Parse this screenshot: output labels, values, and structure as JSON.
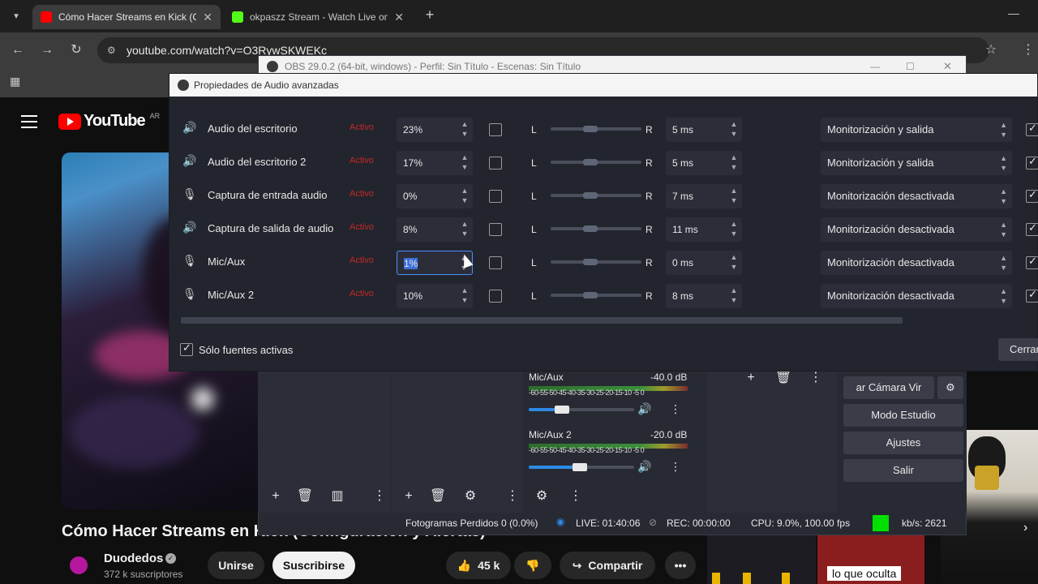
{
  "browser": {
    "tabs": [
      {
        "title": "Cómo Hacer Streams en Kick (C",
        "favicon_color": "#ff0000",
        "active": true
      },
      {
        "title": "okpaszz Stream - Watch Live on",
        "favicon_color": "#53fc18",
        "active": false
      }
    ],
    "url": "youtube.com/watch?v=O3RywSKWEKc"
  },
  "youtube": {
    "logo_text": "YouTube",
    "region": "AR",
    "video_title": "Cómo Hacer Streams en Kick (Configuración y Alertas)",
    "channel_name": "Duodedos",
    "subscribers": "372 k suscriptores",
    "join_label": "Unirse",
    "subscribe_label": "Suscribirse",
    "likes": "45 k",
    "share_label": "Compartir",
    "thumb_caption": "lo que oculta"
  },
  "obs": {
    "window_title": "OBS 29.0.2 (64-bit, windows) - Perfil: Sin Título - Escenas: Sin Título",
    "dialog_title": "Propiedades de Audio avanzadas",
    "rows": [
      {
        "icon": "speaker",
        "name": "Audio del escritorio",
        "sync": "Activo",
        "volume": "23%",
        "mono": false,
        "left": "L",
        "right": "R",
        "offset": "5 ms",
        "monitoring": "Monitorización y salida",
        "track": true
      },
      {
        "icon": "speaker",
        "name": "Audio del escritorio 2",
        "sync": "Activo",
        "volume": "17%",
        "mono": false,
        "left": "L",
        "right": "R",
        "offset": "5 ms",
        "monitoring": "Monitorización y salida",
        "track": true
      },
      {
        "icon": "mic",
        "name": "Captura de entrada audio",
        "sync": "Activo",
        "volume": "0%",
        "mono": false,
        "left": "L",
        "right": "R",
        "offset": "7 ms",
        "monitoring": "Monitorización desactivada",
        "track": true
      },
      {
        "icon": "speaker",
        "name": "Captura de salida de audio",
        "sync": "Activo",
        "volume": "8%",
        "mono": false,
        "left": "L",
        "right": "R",
        "offset": "11 ms",
        "monitoring": "Monitorización desactivada",
        "track": true
      },
      {
        "icon": "mic",
        "name": "Mic/Aux",
        "sync": "Activo",
        "volume": "1%",
        "mono": false,
        "left": "L",
        "right": "R",
        "offset": "0 ms",
        "monitoring": "Monitorización desactivada",
        "track": true
      },
      {
        "icon": "mic",
        "name": "Mic/Aux 2",
        "sync": "Activo",
        "volume": "10%",
        "mono": false,
        "left": "L",
        "right": "R",
        "offset": "8 ms",
        "monitoring": "Monitorización desactivada",
        "track": true
      }
    ],
    "active_only_label": "Sólo fuentes activas",
    "close_label": "Cerrar",
    "mixer": [
      {
        "name": "Mic/Aux",
        "db": "-40.0 dB",
        "ticks": "-60-55-50-45-40-35-30-25-20-15-10 -5  0",
        "level": 0.3
      },
      {
        "name": "Mic/Aux 2",
        "db": "-20.0 dB",
        "ticks": "-60-55-50-45-40-35-30-25-20-15-10 -5  0",
        "level": 0.45
      }
    ],
    "controls": {
      "virtual_cam": "ar Cámara Vir",
      "studio_mode": "Modo Estudio",
      "settings": "Ajustes",
      "exit": "Salir"
    },
    "status": {
      "dropped": "Fotogramas Perdidos 0 (0.0%)",
      "live": "LIVE: 01:40:06",
      "rec": "REC: 00:00:00",
      "cpu": "CPU: 9.0%, 100.00 fps",
      "kbs": "kb/s: 2621"
    }
  }
}
